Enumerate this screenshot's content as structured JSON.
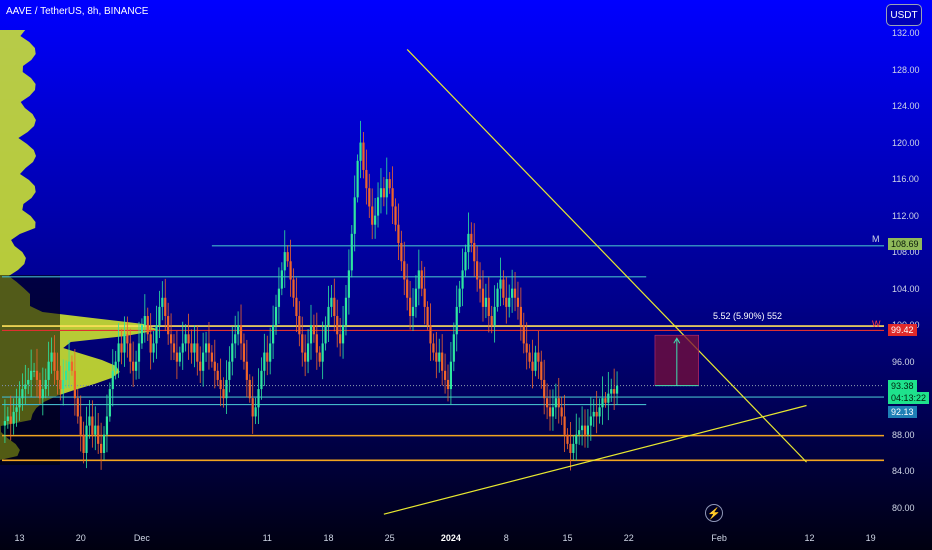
{
  "header": {
    "title": "AAVE / TetherUS, 8h, BINANCE",
    "currency_button": "USDT"
  },
  "colors": {
    "background_top": "#0000ff",
    "background_bottom": "#000000",
    "bull": "#2ee6a0",
    "bear": "#f0642a",
    "trendline": "#e8e830",
    "hline_cyan": "#43b7c9",
    "hline_yellow": "#ffe15a",
    "hline_orange": "#f2a420",
    "hline_red": "#e03030",
    "volume_profile": "#d7ef2a"
  },
  "price_labels": {
    "level_108": "108.69",
    "level_99": "99.42",
    "current_price": "93.38",
    "countdown": "04:13:22",
    "level_92": "92.13",
    "marker_m": "M",
    "marker_w": "W"
  },
  "measure": {
    "label": "5.52 (5.90%) 552"
  },
  "icons": {
    "bolt": "lightning-bolt-icon"
  },
  "chart_data": {
    "type": "candlestick",
    "ylim": [
      78,
      133
    ],
    "y_ticks": [
      "132.00",
      "128.00",
      "124.00",
      "120.00",
      "116.00",
      "112.00",
      "108.00",
      "104.00",
      "100.00",
      "96.00",
      "92.00",
      "88.00",
      "84.00",
      "80.00"
    ],
    "x_ticks": [
      {
        "label": "13",
        "index": 6
      },
      {
        "label": "20",
        "index": 27
      },
      {
        "label": "Dec",
        "index": 48
      },
      {
        "label": "11",
        "index": 91
      },
      {
        "label": "18",
        "index": 112
      },
      {
        "label": "25",
        "index": 133
      },
      {
        "label": "2024",
        "index": 154
      },
      {
        "label": "8",
        "index": 173
      },
      {
        "label": "15",
        "index": 194
      },
      {
        "label": "22",
        "index": 215
      },
      {
        "label": "Feb",
        "index": 246
      },
      {
        "label": "12",
        "index": 277
      },
      {
        "label": "19",
        "index": 298
      }
    ],
    "price_series": [
      89,
      89.5,
      90,
      89.2,
      90.5,
      91,
      92,
      93,
      93.5,
      94,
      95,
      95,
      94,
      92,
      93,
      94,
      96,
      97,
      95,
      94,
      93,
      94,
      95,
      96,
      95,
      92,
      90,
      88,
      86,
      89,
      90,
      88,
      89,
      87,
      86,
      88,
      90,
      93,
      95,
      96,
      98,
      97,
      99,
      98,
      96,
      95,
      96,
      98,
      100,
      101,
      99,
      97,
      98,
      100,
      102,
      103,
      101,
      99,
      98,
      97,
      96,
      97,
      98,
      99,
      98,
      97,
      98,
      96,
      95,
      97,
      98,
      97,
      96,
      95,
      94,
      93,
      92,
      94,
      96,
      98,
      99,
      100,
      98,
      96,
      94,
      92,
      90,
      91,
      93,
      95,
      97,
      96,
      98,
      100,
      102,
      104,
      106,
      108,
      107,
      105,
      103,
      101,
      99,
      97,
      96,
      98,
      100,
      99,
      97,
      96,
      98,
      100,
      102,
      103,
      101,
      99,
      98,
      100,
      103,
      106,
      110,
      114,
      118,
      120,
      117,
      115,
      113,
      111,
      112,
      114,
      115,
      114,
      116,
      115,
      113,
      111,
      109,
      107,
      105,
      103,
      101,
      102,
      104,
      106,
      104,
      102,
      100,
      98,
      97,
      96,
      97,
      95,
      94,
      93,
      96,
      99,
      102,
      104,
      106,
      108,
      110,
      109,
      107,
      105,
      104,
      102,
      103,
      101,
      100,
      102,
      104,
      105,
      103,
      102,
      103,
      104,
      103,
      102,
      100,
      98,
      97,
      96,
      95,
      97,
      96,
      94,
      92,
      91,
      90,
      91,
      92,
      91,
      90,
      88,
      87,
      86,
      87,
      88,
      88.5,
      89,
      88,
      89,
      90,
      90.5,
      90,
      91,
      92,
      91.5,
      92.5,
      93,
      92.5,
      93.38
    ],
    "trendlines": [
      {
        "from": [
          139,
          130.2
        ],
        "to": [
          276,
          85.0
        ]
      },
      {
        "from": [
          131,
          79.3
        ],
        "to": [
          276,
          91.2
        ]
      }
    ],
    "horizontal_levels": [
      {
        "value": 108.69,
        "color": "hline_cyan",
        "start_index": 72
      },
      {
        "value": 105.3,
        "color": "hline_cyan",
        "start_index": 0,
        "end_index": 221
      },
      {
        "value": 99.9,
        "color": "hline_yellow",
        "start_index": 0
      },
      {
        "value": 99.42,
        "color": "hline_red",
        "start_index": 0
      },
      {
        "value": 93.38,
        "color": "dotted",
        "start_index": 0
      },
      {
        "value": 92.13,
        "color": "hline_cyan",
        "start_index": 0
      },
      {
        "value": 91.3,
        "color": "hline_cyan",
        "start_index": 0,
        "end_index": 221
      },
      {
        "value": 87.9,
        "color": "hline_orange",
        "start_index": 0
      },
      {
        "value": 85.2,
        "color": "hline_orange",
        "start_index": 0
      }
    ],
    "measure_box": {
      "x_start": 224,
      "x_end": 239,
      "y_top": 98.9,
      "y_bottom": 93.38
    }
  }
}
